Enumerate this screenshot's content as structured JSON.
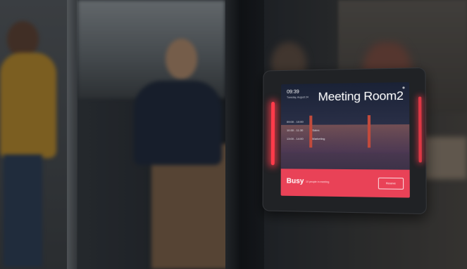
{
  "scene": {
    "description_tag": ""
  },
  "tablet": {
    "screen": {
      "time": "09:39",
      "date": "Tuesday, August 24",
      "room_name": "Meeting Room2",
      "schedule": [
        {
          "time": "09:00 - 10:00",
          "title": ""
        },
        {
          "time": "10:30 - 11:30",
          "title": "Sales"
        },
        {
          "time": "13:00 - 14:00",
          "title": "Marketing"
        }
      ],
      "status": "Busy",
      "status_detail": "10 people in meeting",
      "reserve_label": "Reserve"
    },
    "led_color": "#ff3b4a",
    "status_bar_color": "#e94257"
  }
}
